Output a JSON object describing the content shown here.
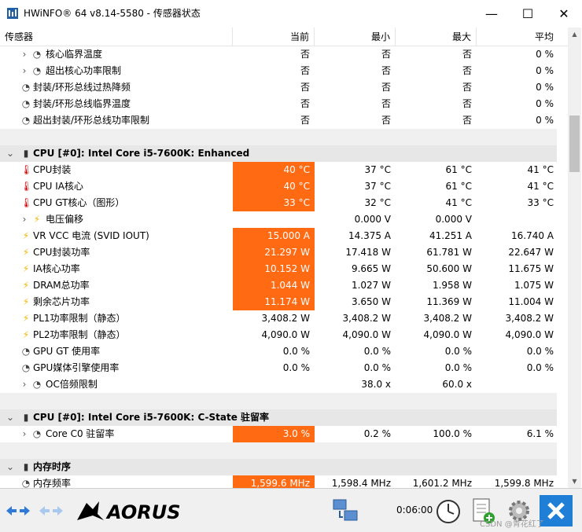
{
  "window": {
    "title": "HWiNFO® 64 v8.14-5580 - 传感器状态",
    "minimize": "—",
    "maximize": "☐",
    "close": "✕"
  },
  "columns": {
    "sensor": "传感器",
    "current": "当前",
    "min": "最小",
    "max": "最大",
    "avg": "平均"
  },
  "rows": [
    {
      "kind": "item",
      "indent": 1,
      "chevron": "›",
      "icon": "clock",
      "name": "核心临界温度",
      "current": "否",
      "min": "否",
      "max": "否",
      "avg": "0 %",
      "hot": false
    },
    {
      "kind": "item",
      "indent": 1,
      "chevron": "›",
      "icon": "clock",
      "name": "超出核心功率限制",
      "current": "否",
      "min": "否",
      "max": "否",
      "avg": "0 %",
      "hot": false
    },
    {
      "kind": "item",
      "indent": 0,
      "chevron": "",
      "icon": "clock",
      "name": "封装/环形总线过热降频",
      "current": "否",
      "min": "否",
      "max": "否",
      "avg": "0 %",
      "hot": false
    },
    {
      "kind": "item",
      "indent": 0,
      "chevron": "",
      "icon": "clock",
      "name": "封装/环形总线临界温度",
      "current": "否",
      "min": "否",
      "max": "否",
      "avg": "0 %",
      "hot": false
    },
    {
      "kind": "item",
      "indent": 0,
      "chevron": "",
      "icon": "clock",
      "name": "超出封装/环形总线功率限制",
      "current": "否",
      "min": "否",
      "max": "否",
      "avg": "0 %",
      "hot": false
    },
    {
      "kind": "sep"
    },
    {
      "kind": "section",
      "name": "CPU [#0]: Intel Core i5-7600K: Enhanced"
    },
    {
      "kind": "item",
      "indent": 0,
      "chevron": "",
      "icon": "therm",
      "name": "CPU封装",
      "current": "40 °C",
      "min": "37 °C",
      "max": "61 °C",
      "avg": "41 °C",
      "hot": true
    },
    {
      "kind": "item",
      "indent": 0,
      "chevron": "",
      "icon": "therm",
      "name": "CPU IA核心",
      "current": "40 °C",
      "min": "37 °C",
      "max": "61 °C",
      "avg": "41 °C",
      "hot": true
    },
    {
      "kind": "item",
      "indent": 0,
      "chevron": "",
      "icon": "therm",
      "name": "CPU GT核心（图形）",
      "current": "33 °C",
      "min": "32 °C",
      "max": "41 °C",
      "avg": "33 °C",
      "hot": true
    },
    {
      "kind": "item",
      "indent": 1,
      "chevron": "›",
      "icon": "bolt",
      "name": "电压偏移",
      "current": "",
      "min": "0.000 V",
      "max": "0.000 V",
      "avg": "",
      "hot": false
    },
    {
      "kind": "item",
      "indent": 0,
      "chevron": "",
      "icon": "bolt",
      "name": "VR VCC 电流 (SVID IOUT)",
      "current": "15.000 A",
      "min": "14.375 A",
      "max": "41.251 A",
      "avg": "16.740 A",
      "hot": true
    },
    {
      "kind": "item",
      "indent": 0,
      "chevron": "",
      "icon": "bolt",
      "name": "CPU封装功率",
      "current": "21.297 W",
      "min": "17.418 W",
      "max": "61.781 W",
      "avg": "22.647 W",
      "hot": true
    },
    {
      "kind": "item",
      "indent": 0,
      "chevron": "",
      "icon": "bolt",
      "name": "IA核心功率",
      "current": "10.152 W",
      "min": "9.665 W",
      "max": "50.600 W",
      "avg": "11.675 W",
      "hot": true
    },
    {
      "kind": "item",
      "indent": 0,
      "chevron": "",
      "icon": "bolt",
      "name": "DRAM总功率",
      "current": "1.044 W",
      "min": "1.027 W",
      "max": "1.958 W",
      "avg": "1.075 W",
      "hot": true
    },
    {
      "kind": "item",
      "indent": 0,
      "chevron": "",
      "icon": "bolt",
      "name": "剩余芯片功率",
      "current": "11.174 W",
      "min": "3.650 W",
      "max": "11.369 W",
      "avg": "11.004 W",
      "hot": true
    },
    {
      "kind": "item",
      "indent": 0,
      "chevron": "",
      "icon": "bolt",
      "name": "PL1功率限制（静态）",
      "current": "3,408.2 W",
      "min": "3,408.2 W",
      "max": "3,408.2 W",
      "avg": "3,408.2 W",
      "hot": false
    },
    {
      "kind": "item",
      "indent": 0,
      "chevron": "",
      "icon": "bolt",
      "name": "PL2功率限制（静态）",
      "current": "4,090.0 W",
      "min": "4,090.0 W",
      "max": "4,090.0 W",
      "avg": "4,090.0 W",
      "hot": false
    },
    {
      "kind": "item",
      "indent": 0,
      "chevron": "",
      "icon": "clock",
      "name": "GPU GT 使用率",
      "current": "0.0 %",
      "min": "0.0 %",
      "max": "0.0 %",
      "avg": "0.0 %",
      "hot": false
    },
    {
      "kind": "item",
      "indent": 0,
      "chevron": "",
      "icon": "clock",
      "name": "GPU媒体引擎使用率",
      "current": "0.0 %",
      "min": "0.0 %",
      "max": "0.0 %",
      "avg": "0.0 %",
      "hot": false
    },
    {
      "kind": "item",
      "indent": 1,
      "chevron": "›",
      "icon": "clock",
      "name": "OC倍频限制",
      "current": "",
      "min": "38.0 x",
      "max": "60.0 x",
      "avg": "",
      "hot": false
    },
    {
      "kind": "sep"
    },
    {
      "kind": "section",
      "name": "CPU [#0]: Intel Core i5-7600K: C-State 驻留率"
    },
    {
      "kind": "item",
      "indent": 1,
      "chevron": "›",
      "icon": "clock",
      "name": "Core C0 驻留率",
      "current": "3.0 %",
      "min": "0.2 %",
      "max": "100.0 %",
      "avg": "6.1 %",
      "hot": true
    },
    {
      "kind": "sep"
    },
    {
      "kind": "section",
      "name": "内存时序"
    },
    {
      "kind": "item",
      "indent": 0,
      "chevron": "",
      "icon": "clock",
      "name": "内存频率",
      "current": "1,599.6 MHz",
      "min": "1,598.4 MHz",
      "max": "1,601.2 MHz",
      "avg": "1,599.8 MHz",
      "hot": true
    }
  ],
  "footer": {
    "brand": "AORUS",
    "elapsed": "0:06:00",
    "watermark": "CSDN @青花红了"
  }
}
